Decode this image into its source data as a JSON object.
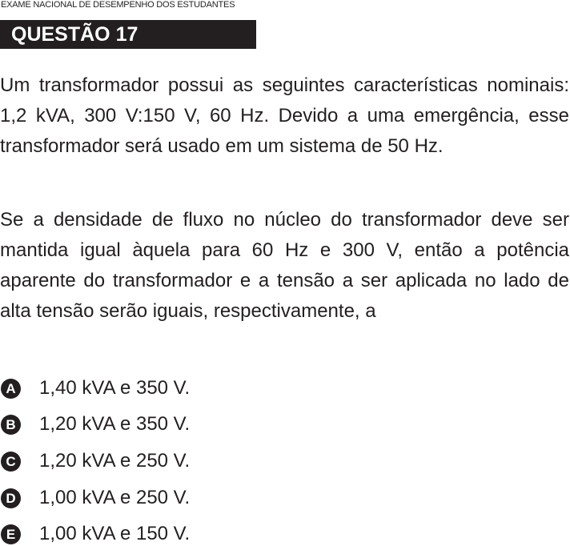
{
  "header": {
    "exam_title": "EXAME NACIONAL DE DESEMPENHO DOS ESTUDANTES"
  },
  "question": {
    "title": "QUESTÃO 17",
    "paragraphs": [
      "Um transformador possui as seguintes características nominais: 1,2 kVA, 300 V:150 V, 60 Hz. Devido a uma emergência, esse transformador será usado em um sistema de 50 Hz.",
      "Se a densidade de fluxo no núcleo do transformador deve ser mantida igual àquela para 60 Hz e 300 V, então a potência aparente do transformador e a tensão a ser aplicada no lado de alta tensão serão iguais, respectivamente, a"
    ],
    "options": [
      {
        "letter": "A",
        "text": "1,40 kVA e 350 V."
      },
      {
        "letter": "B",
        "text": "1,20 kVA e 350 V."
      },
      {
        "letter": "C",
        "text": "1,20 kVA e 250 V."
      },
      {
        "letter": "D",
        "text": "1,00 kVA e 250 V."
      },
      {
        "letter": "E",
        "text": "1,00 kVA e 150 V."
      }
    ]
  },
  "colors": {
    "text": "#231f20",
    "banner_background": "#231f20",
    "banner_text": "#ffffff"
  }
}
